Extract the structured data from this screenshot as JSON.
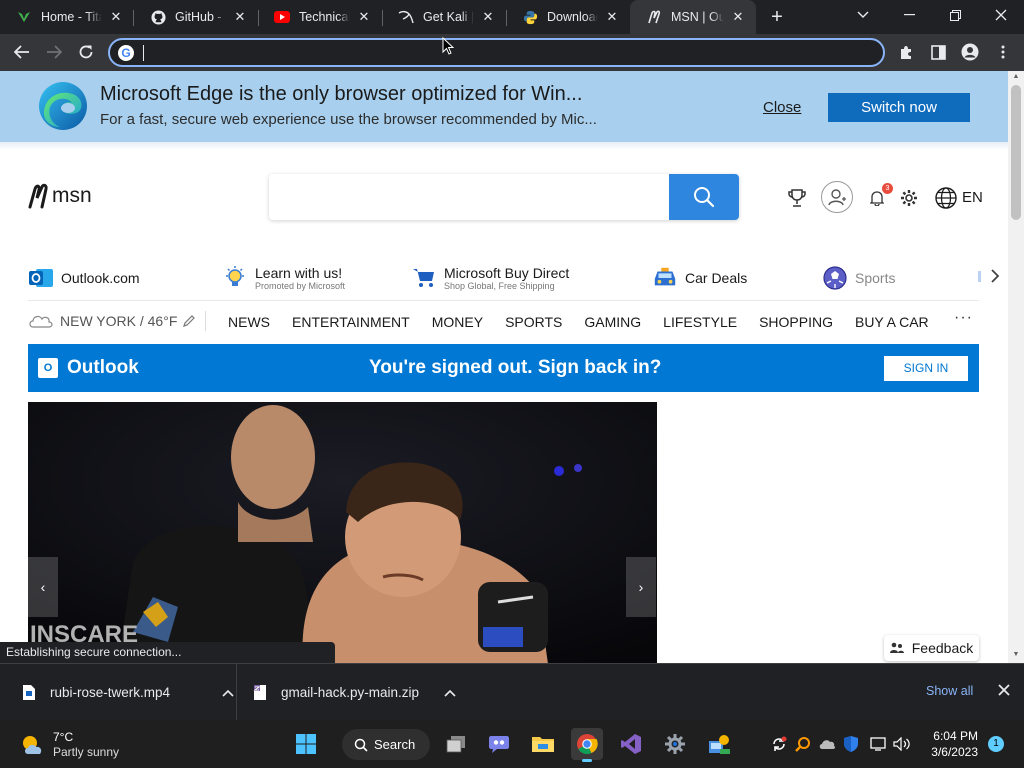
{
  "browser": {
    "tabs": [
      {
        "title": "Home - Tita",
        "icon": "titan-leaf-icon"
      },
      {
        "title": "GitHub - ak",
        "icon": "github-icon"
      },
      {
        "title": "Technical A",
        "icon": "youtube-icon"
      },
      {
        "title": "Get Kali | K",
        "icon": "kali-dragon-icon"
      },
      {
        "title": "Download",
        "icon": "python-icon"
      },
      {
        "title": "MSN | Outl",
        "icon": "msn-icon",
        "active": true
      }
    ],
    "omnibox": {
      "value": "",
      "placeholder": ""
    }
  },
  "edge_banner": {
    "headline": "Microsoft Edge is the only browser optimized for Win...",
    "subtext": "For a fast, secure web experience use the browser recommended by Mic...",
    "close_label": "Close",
    "switch_label": "Switch now"
  },
  "msn": {
    "logo_text": "msn",
    "search": {
      "value": "",
      "placeholder": ""
    },
    "notification_count": "3",
    "language": "EN",
    "quick_links": [
      {
        "title": "Outlook.com",
        "subtitle": "",
        "icon": "outlook-icon"
      },
      {
        "title": "Learn with us!",
        "subtitle": "Promoted by Microsoft",
        "icon": "lightbulb-icon"
      },
      {
        "title": "Microsoft Buy Direct",
        "subtitle": "Shop Global, Free Shipping",
        "icon": "cart-icon"
      },
      {
        "title": "Car Deals",
        "subtitle": "",
        "icon": "car-icon"
      },
      {
        "title": "Sports",
        "subtitle": "",
        "icon": "sports-ball-icon"
      }
    ],
    "weather": "NEW YORK / 46°F",
    "nav": [
      "NEWS",
      "ENTERTAINMENT",
      "MONEY",
      "SPORTS",
      "GAMING",
      "LIFESTYLE",
      "SHOPPING",
      "BUY A CAR"
    ],
    "nav_more": "···",
    "outlook_bar": {
      "brand": "Outlook",
      "message": "You're signed out. Sign back in?",
      "signin": "SIGN IN"
    },
    "feedback": "Feedback"
  },
  "status_text": "Establishing secure connection...",
  "downloads": {
    "items": [
      {
        "name": "rubi-rose-twerk.mp4"
      },
      {
        "name": "gmail-hack.py-main.zip"
      }
    ],
    "show_all": "Show all"
  },
  "taskbar": {
    "weather_temp": "7°C",
    "weather_desc": "Partly sunny",
    "search_label": "Search",
    "time": "6:04 PM",
    "date": "3/6/2023",
    "notification_count": "1"
  }
}
